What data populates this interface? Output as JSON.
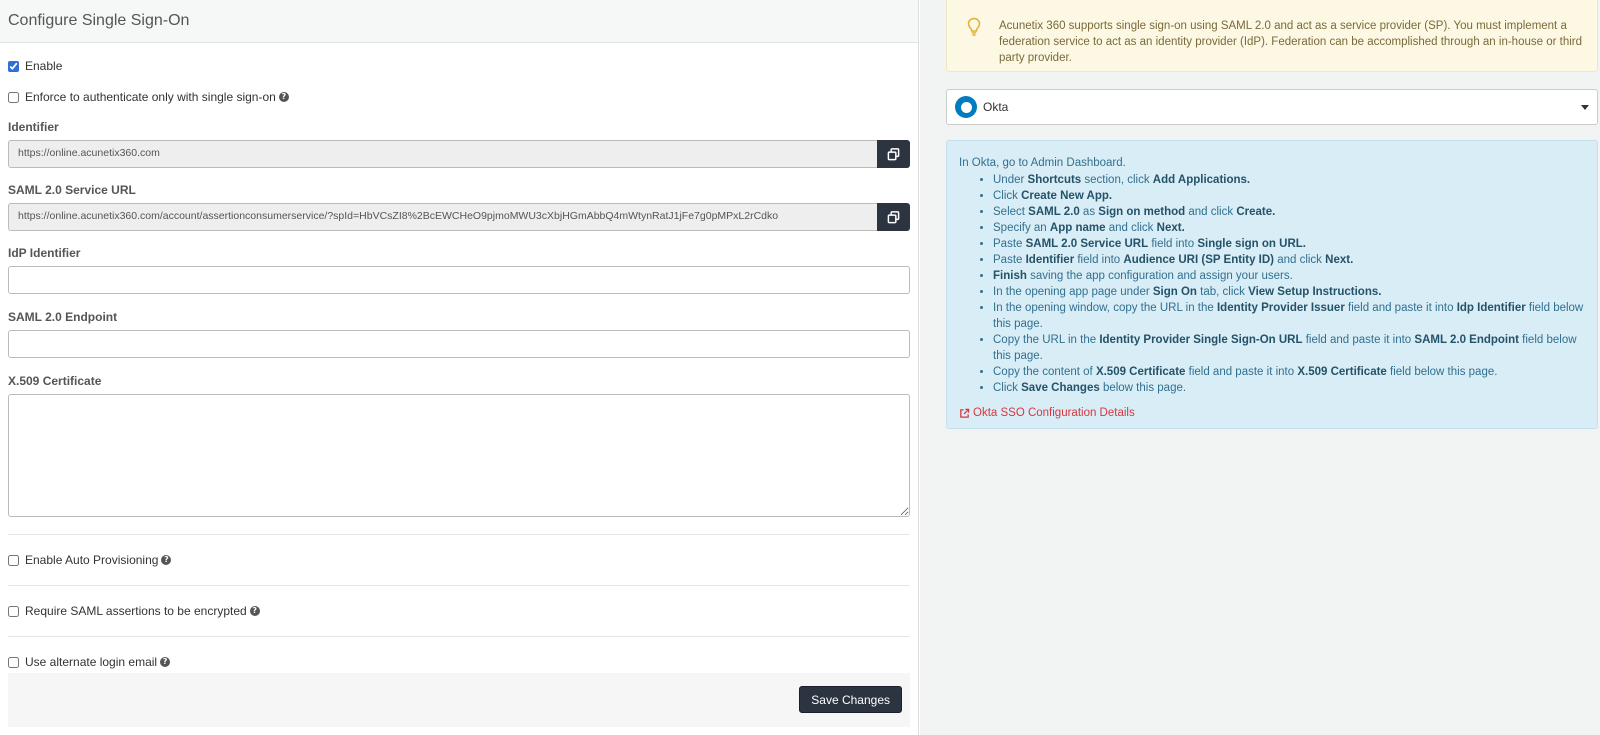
{
  "page": {
    "title": "Configure Single Sign-On"
  },
  "form": {
    "enable_label": "Enable",
    "enforce_label": "Enforce to authenticate only with single sign-on",
    "identifier_label": "Identifier",
    "identifier_value": "https://online.acunetix360.com",
    "saml_service_url_label": "SAML 2.0 Service URL",
    "saml_service_url_value": "https://online.acunetix360.com/account/assertionconsumerservice/?spId=HbVCsZI8%2BcEWCHeO9pjmoMWU3cXbjHGmAbbQ4mWtynRatJ1jFe7g0pMPxL2rCdko",
    "idp_identifier_label": "IdP Identifier",
    "idp_identifier_value": "",
    "saml_endpoint_label": "SAML 2.0 Endpoint",
    "saml_endpoint_value": "",
    "certificate_label": "X.509 Certificate",
    "certificate_value": "",
    "auto_provisioning_label": "Enable Auto Provisioning",
    "encrypted_label": "Require SAML assertions to be encrypted",
    "alternate_email_label": "Use alternate login email",
    "save_label": "Save Changes",
    "enable_checked": true,
    "enforce_checked": false,
    "auto_provisioning_checked": false,
    "encrypted_checked": false,
    "alternate_email_checked": false
  },
  "help_icon_glyph": "?",
  "alert": {
    "icon": "lightbulb-icon",
    "text": "Acunetix 360 supports single sign-on using SAML 2.0 and act as a service provider (SP). You must implement a federation service to act as an identity provider (IdP). Federation can be accomplished through an in-house or third party provider."
  },
  "provider_select": {
    "selected": "Okta",
    "icon": "okta-logo-icon"
  },
  "instructions": {
    "intro": "In Okta, go to Admin Dashboard.",
    "steps": [
      [
        {
          "t": "Under "
        },
        {
          "t": "Shortcuts",
          "b": true
        },
        {
          "t": " section, click "
        },
        {
          "t": "Add Applications.",
          "b": true
        }
      ],
      [
        {
          "t": "Click "
        },
        {
          "t": "Create New App.",
          "b": true
        }
      ],
      [
        {
          "t": "Select "
        },
        {
          "t": "SAML 2.0",
          "b": true
        },
        {
          "t": " as "
        },
        {
          "t": "Sign on method",
          "b": true
        },
        {
          "t": " and click "
        },
        {
          "t": "Create.",
          "b": true
        }
      ],
      [
        {
          "t": "Specify an "
        },
        {
          "t": "App name",
          "b": true
        },
        {
          "t": " and click "
        },
        {
          "t": "Next.",
          "b": true
        }
      ],
      [
        {
          "t": "Paste "
        },
        {
          "t": "SAML 2.0 Service URL",
          "b": true
        },
        {
          "t": " field into "
        },
        {
          "t": "Single sign on URL.",
          "b": true
        }
      ],
      [
        {
          "t": "Paste "
        },
        {
          "t": "Identifier",
          "b": true
        },
        {
          "t": " field into "
        },
        {
          "t": "Audience URI (SP Entity ID)",
          "b": true
        },
        {
          "t": " and click "
        },
        {
          "t": "Next.",
          "b": true
        }
      ],
      [
        {
          "t": "Finish",
          "b": true
        },
        {
          "t": " saving the app configuration and assign your users."
        }
      ],
      [
        {
          "t": "In the opening app page under "
        },
        {
          "t": "Sign On",
          "b": true
        },
        {
          "t": " tab, click "
        },
        {
          "t": "View Setup Instructions.",
          "b": true
        }
      ],
      [
        {
          "t": "In the opening window, copy the URL in the "
        },
        {
          "t": "Identity Provider Issuer",
          "b": true
        },
        {
          "t": " field and paste it into "
        },
        {
          "t": "Idp Identifier",
          "b": true
        },
        {
          "t": " field below this page."
        }
      ],
      [
        {
          "t": "Copy the URL in the "
        },
        {
          "t": "Identity Provider Single Sign-On URL",
          "b": true
        },
        {
          "t": " field and paste it into "
        },
        {
          "t": "SAML 2.0 Endpoint",
          "b": true
        },
        {
          "t": " field below this page."
        }
      ],
      [
        {
          "t": "Copy the content of "
        },
        {
          "t": "X.509 Certificate",
          "b": true
        },
        {
          "t": " field and paste it into "
        },
        {
          "t": "X.509 Certificate",
          "b": true
        },
        {
          "t": " field below this page."
        }
      ],
      [
        {
          "t": "Click "
        },
        {
          "t": "Save Changes",
          "b": true
        },
        {
          "t": " below this page."
        }
      ]
    ],
    "link_text": "Okta SSO Configuration Details",
    "link_icon": "external-link-icon"
  },
  "colors": {
    "dark_button": "#2c3341",
    "alert_bg": "#fcf8e3",
    "info_bg": "#d9edf7",
    "info_text": "#31708f",
    "link_red": "#d9363e",
    "okta_blue": "#007dc1",
    "checkbox_blue": "#2f6fd6"
  }
}
